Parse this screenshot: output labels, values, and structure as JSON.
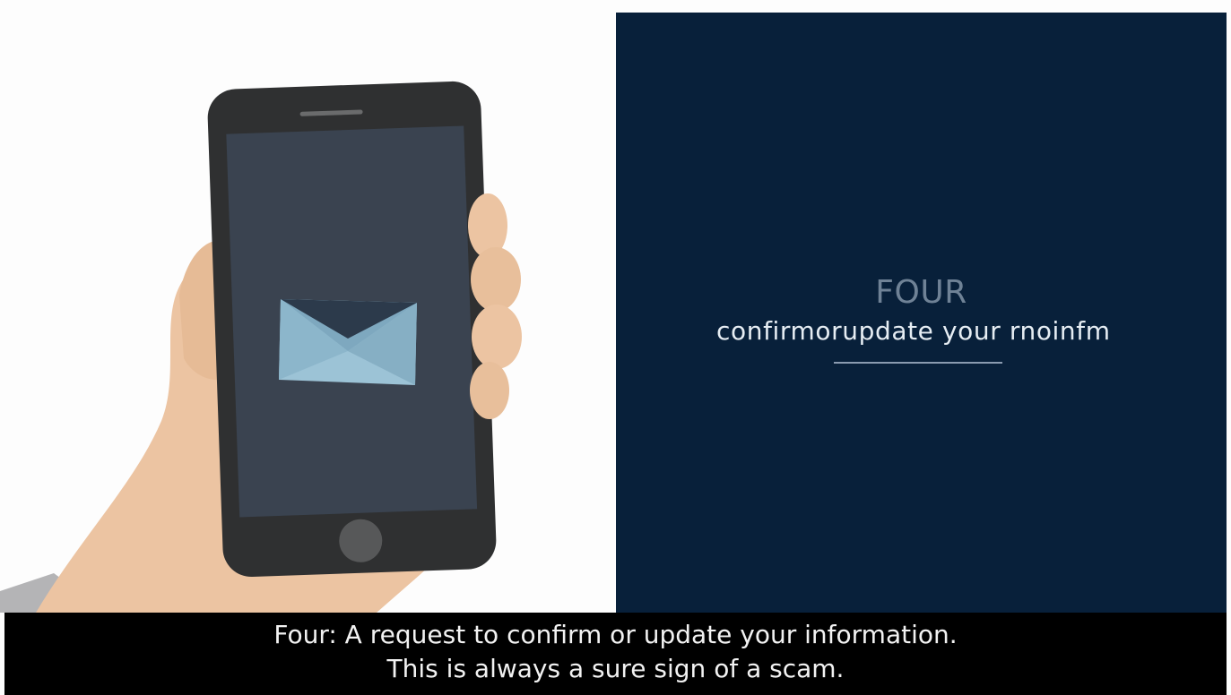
{
  "slide": {
    "step_label": "FOUR",
    "step_text": "confirmorupdate your rnoinfm",
    "colors": {
      "panel_background": "#08203a",
      "step_label": "#6f8296",
      "step_text": "#e6edf3",
      "underline": "#8a9bb0",
      "phone_body": "#2f3031",
      "phone_screen": "#3a4350",
      "envelope": "#9cc3d6",
      "skin": "#ecc4a2"
    }
  },
  "caption": {
    "line1": "Four: A request to confirm or update your information.",
    "line2": "This is always a sure sign of a scam."
  },
  "icons": {
    "envelope": "envelope-icon",
    "home_button": "home-button-icon"
  }
}
